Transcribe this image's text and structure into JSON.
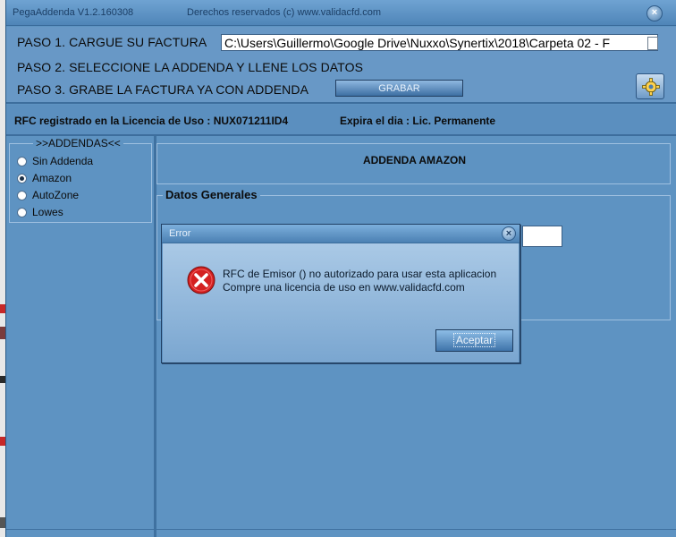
{
  "window": {
    "app_title": "PegaAddenda V1.2.160308",
    "rights": "Derechos reservados (c) www.validacfd.com",
    "close_glyph": "×"
  },
  "steps": {
    "step1": "PASO 1. CARGUE SU FACTURA",
    "step2": "PASO 2. SELECCIONE LA ADDENDA Y LLENE LOS DATOS",
    "step3": "PASO 3. GRABE LA FACTURA YA CON ADDENDA",
    "file_path": "C:\\Users\\Guillermo\\Google Drive\\Nuxxo\\Synertix\\2018\\Carpeta 02 - F",
    "grabar_label": "GRABAR",
    "config_icon": "gear-icon"
  },
  "license": {
    "rfc_text": "RFC registrado en la Licencia de Uso : NUX071211ID4",
    "expira_text": "Expira el dia : Lic. Permanente"
  },
  "addendas": {
    "legend": ">>ADDENDAS<<",
    "options": [
      {
        "label": "Sin Addenda",
        "selected": false
      },
      {
        "label": "Amazon",
        "selected": true
      },
      {
        "label": "AutoZone",
        "selected": false
      },
      {
        "label": "Lowes",
        "selected": false
      }
    ]
  },
  "main": {
    "addenda_title": "ADDENDA AMAZON",
    "datos_legend": "Datos Generales"
  },
  "dialog": {
    "title": "Error",
    "line1": "RFC de Emisor () no autorizado para usar esta aplicacion",
    "line2": "Compre una licencia de uso en www.validacfd.com",
    "accept_label": "Aceptar",
    "icon": "error-icon"
  },
  "colors": {
    "window_bg": "#5e93c2",
    "accent": "#3d6e9d",
    "error_red": "#d42020"
  }
}
